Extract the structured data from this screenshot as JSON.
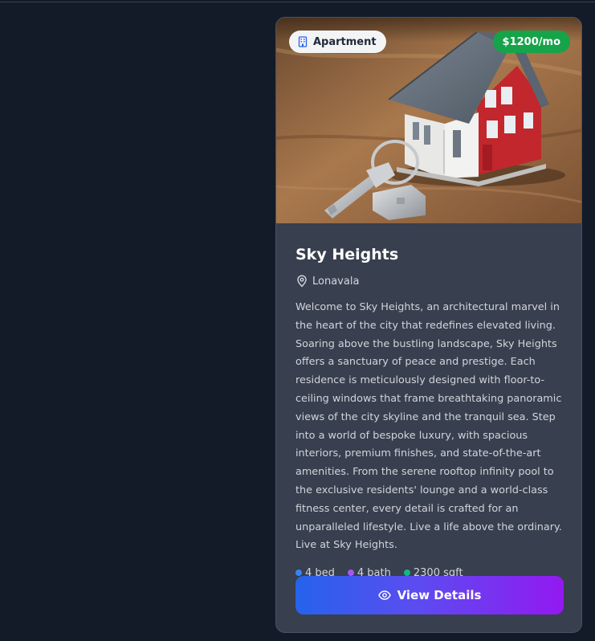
{
  "listing": {
    "type_label": "Apartment",
    "type_icon": "building-icon",
    "price": "$1200/mo",
    "title": "Sky Heights",
    "location": "Lonavala",
    "description": "Welcome to Sky Heights, an architectural marvel in the heart of the city that redefines elevated living. Soaring above the bustling landscape, Sky Heights offers a sanctuary of peace and prestige. Each residence is meticulously designed with floor-to-ceiling windows that frame breathtaking panoramic views of the city skyline and the tranquil sea. Step into a world of bespoke luxury, with spacious interiors, premium finishes, and state-of-the-art amenities. From the serene rooftop infinity pool to the exclusive residents' lounge and a world-class fitness center, every detail is crafted for an unparalleled lifestyle. Live a life above the ordinary. Live at Sky Heights.",
    "stats": [
      {
        "label": "4 bed",
        "color": "#3b82f6"
      },
      {
        "label": "4 bath",
        "color": "#a855f7"
      },
      {
        "label": "2300 sqft",
        "color": "#10b981"
      }
    ],
    "button_label": "View Details",
    "button_icon": "eye-icon"
  },
  "colors": {
    "page_bg": "#131a28",
    "card_bg": "#383f4e",
    "price_badge": "#16a34a",
    "button_gradient_start": "#2563eb",
    "button_gradient_end": "#9319f1"
  }
}
